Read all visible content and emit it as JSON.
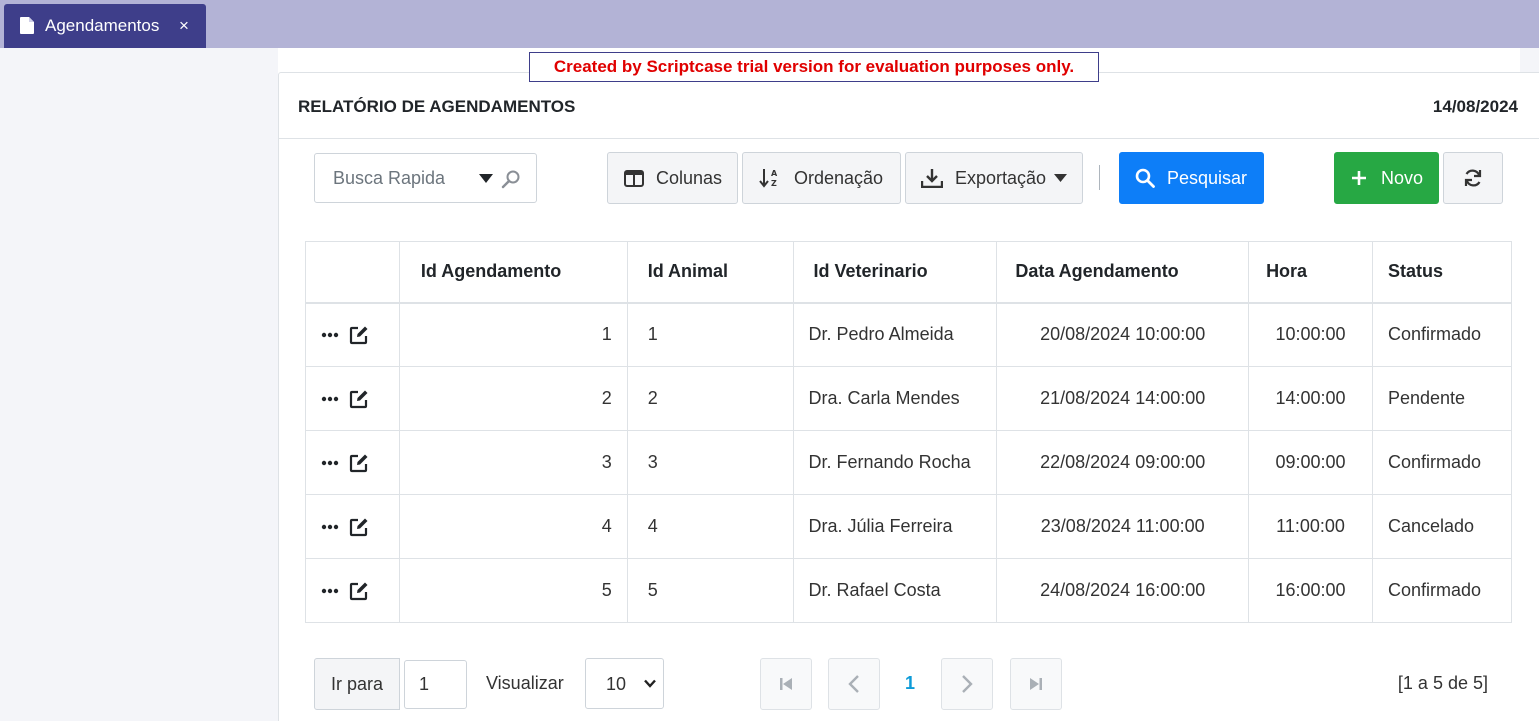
{
  "tab": {
    "label": "Agendamentos",
    "close": "×"
  },
  "trial_banner": "Created by Scriptcase trial version for evaluation purposes only.",
  "header": {
    "title": "RELATÓRIO DE AGENDAMENTOS",
    "date": "14/08/2024"
  },
  "toolbar": {
    "search_placeholder": "Busca Rapida",
    "columns_label": "Colunas",
    "sort_label": "Ordenação",
    "export_label": "Exportação",
    "search_button_label": "Pesquisar",
    "new_label": "Novo"
  },
  "table": {
    "columns": [
      "",
      "Id Agendamento",
      "Id Animal",
      "Id Veterinario",
      "Data Agendamento",
      "Hora",
      "Status"
    ],
    "rows": [
      {
        "id": "1",
        "animal": "1",
        "vet": "Dr. Pedro Almeida",
        "date": "20/08/2024 10:00:00",
        "hour": "10:00:00",
        "status": "Confirmado"
      },
      {
        "id": "2",
        "animal": "2",
        "vet": "Dra. Carla Mendes",
        "date": "21/08/2024 14:00:00",
        "hour": "14:00:00",
        "status": "Pendente"
      },
      {
        "id": "3",
        "animal": "3",
        "vet": "Dr. Fernando Rocha",
        "date": "22/08/2024 09:00:00",
        "hour": "09:00:00",
        "status": "Confirmado"
      },
      {
        "id": "4",
        "animal": "4",
        "vet": "Dra. Júlia Ferreira",
        "date": "23/08/2024 11:00:00",
        "hour": "11:00:00",
        "status": "Cancelado"
      },
      {
        "id": "5",
        "animal": "5",
        "vet": "Dr. Rafael Costa",
        "date": "24/08/2024 16:00:00",
        "hour": "16:00:00",
        "status": "Confirmado"
      }
    ]
  },
  "pager": {
    "goto_label": "Ir para",
    "goto_value": "1",
    "view_label": "Visualizar",
    "page_size": "10",
    "current_page": "1",
    "summary": "[1 a 5 de 5]"
  },
  "colors": {
    "tabbar": "#b3b3d6",
    "tab": "#3e3e8a",
    "primary": "#0d7ef8",
    "success": "#27a844",
    "trial_text": "#e00000",
    "active_page": "#0d9bd8"
  }
}
